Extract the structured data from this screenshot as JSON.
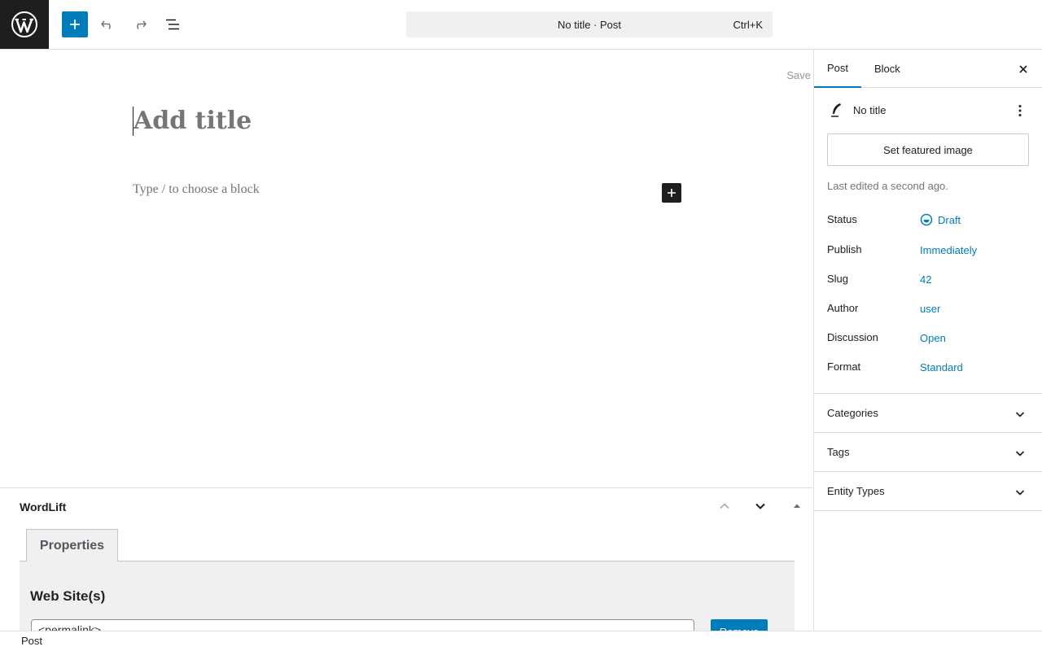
{
  "toolbar": {
    "command_title": "No title · Post",
    "command_shortcut": "Ctrl+K",
    "icons": [
      "wordpress-logo-icon",
      "plus-icon",
      "undo-icon",
      "redo-icon",
      "document-overview-icon"
    ]
  },
  "editor": {
    "save_label": "Save",
    "title_placeholder": "Add title",
    "block_placeholder": "Type / to choose a block"
  },
  "metabox": {
    "title": "WordLift",
    "tab_label": "Properties",
    "section_title": "Web Site(s)",
    "input_value": "<permalink>",
    "remove_label": "Remove"
  },
  "sidebar": {
    "tabs": [
      {
        "label": "Post",
        "active": true
      },
      {
        "label": "Block",
        "active": false
      }
    ],
    "post_title": "No title",
    "featured_image_label": "Set featured image",
    "last_edited": "Last edited a second ago.",
    "rows": [
      {
        "label": "Status",
        "value": "Draft"
      },
      {
        "label": "Publish",
        "value": "Immediately"
      },
      {
        "label": "Slug",
        "value": "42"
      },
      {
        "label": "Author",
        "value": "user"
      },
      {
        "label": "Discussion",
        "value": "Open"
      },
      {
        "label": "Format",
        "value": "Standard"
      }
    ],
    "panels": [
      {
        "label": "Categories"
      },
      {
        "label": "Tags"
      },
      {
        "label": "Entity Types"
      }
    ]
  },
  "footer": {
    "breadcrumb": "Post"
  },
  "colors": {
    "accent": "#007cba",
    "dark": "#1e1e1e",
    "muted": "#757575",
    "border": "#e0e0e0"
  }
}
